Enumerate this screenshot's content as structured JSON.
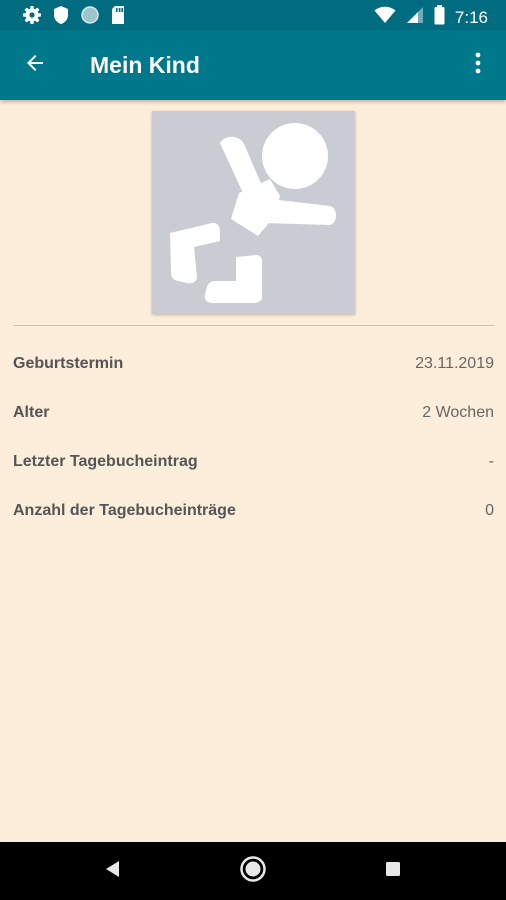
{
  "status_bar": {
    "time": "7:16",
    "icons": [
      "gear-icon",
      "shield-icon",
      "circle-icon",
      "sd-card-icon",
      "wifi-icon",
      "cell-signal-icon",
      "battery-icon"
    ]
  },
  "app_bar": {
    "title": "Mein Kind",
    "back_icon": "arrow-left-icon",
    "menu_icon": "more-vert-icon"
  },
  "avatar": {
    "icon": "baby-icon"
  },
  "details": [
    {
      "label": "Geburtstermin",
      "value": "23.11.2019"
    },
    {
      "label": "Alter",
      "value": "2 Wochen"
    },
    {
      "label": "Letzter Tagebucheintrag",
      "value": "-"
    },
    {
      "label": "Anzahl der Tagebucheinträge",
      "value": "0"
    }
  ],
  "nav_bar": {
    "back_icon": "nav-back-icon",
    "home_icon": "nav-home-icon",
    "recents_icon": "nav-recents-icon"
  },
  "colors": {
    "status_bar": "#006c7f",
    "app_bar": "#00788b",
    "background": "#fdeedb",
    "avatar_bg": "#c9ccd3"
  }
}
